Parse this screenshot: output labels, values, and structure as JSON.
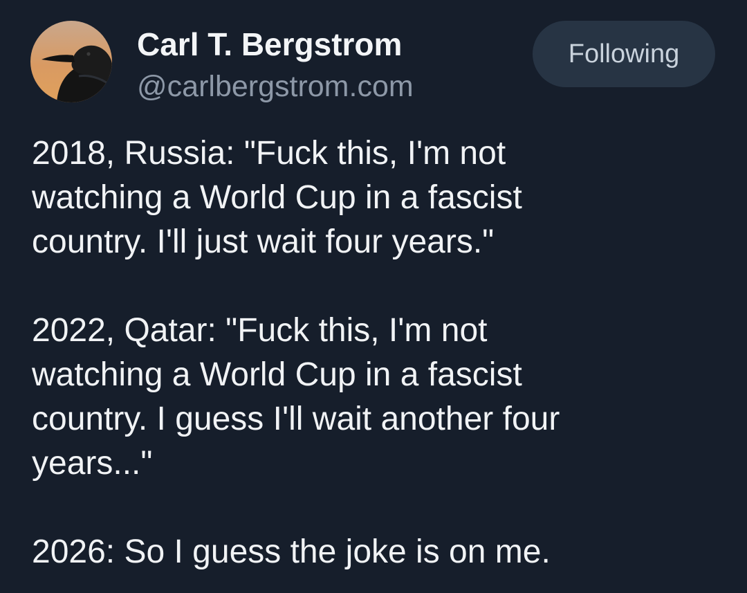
{
  "author": {
    "display_name": "Carl T. Bergstrom",
    "handle": "@carlbergstrom.com",
    "avatar_icon": "crow-avatar"
  },
  "follow_button": {
    "label": "Following"
  },
  "post": {
    "paragraphs": [
      "2018, Russia: \"Fuck this, I'm not\nwatching a World Cup in a fascist\ncountry. I'll just wait four years.\"",
      "2022, Qatar: \"Fuck this, I'm not\nwatching a World Cup in a fascist\ncountry. I guess I'll wait another four\nyears...\"",
      "2026: So I guess the joke is on me."
    ]
  },
  "colors": {
    "background": "#161e2b",
    "text": "#f1f3f5",
    "handle": "#8d98a7",
    "button_bg": "#273444"
  }
}
